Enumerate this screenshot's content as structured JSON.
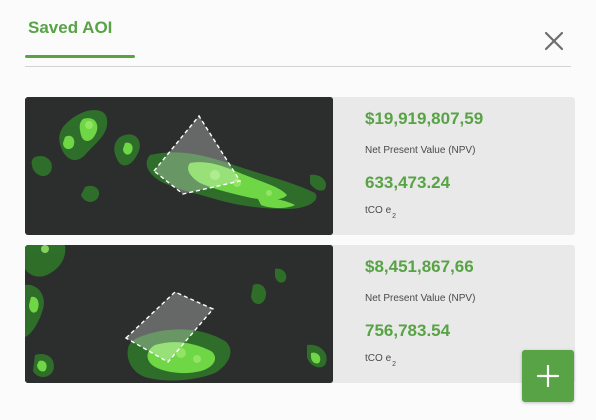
{
  "header": {
    "tab_label": "Saved AOI",
    "close_icon": "close-icon"
  },
  "cards": [
    {
      "npv_value": "$19,919,807,59",
      "npv_label": "Net Present Value (NPV)",
      "co2_value": "633,473.24",
      "co2_label": "tCO",
      "co2_sub": "e",
      "co2_sub2": "2"
    },
    {
      "npv_value": "$8,451,867,66",
      "npv_label": "Net Present Value (NPV)",
      "co2_value": "756,783.54",
      "co2_label": "tCO",
      "co2_sub": "e",
      "co2_sub2": "2"
    }
  ],
  "add_button": {
    "icon": "plus-icon"
  },
  "colors": {
    "accent": "#58a346",
    "map_bg": "#2c2e2d",
    "card_bg": "#e9e9e9"
  }
}
